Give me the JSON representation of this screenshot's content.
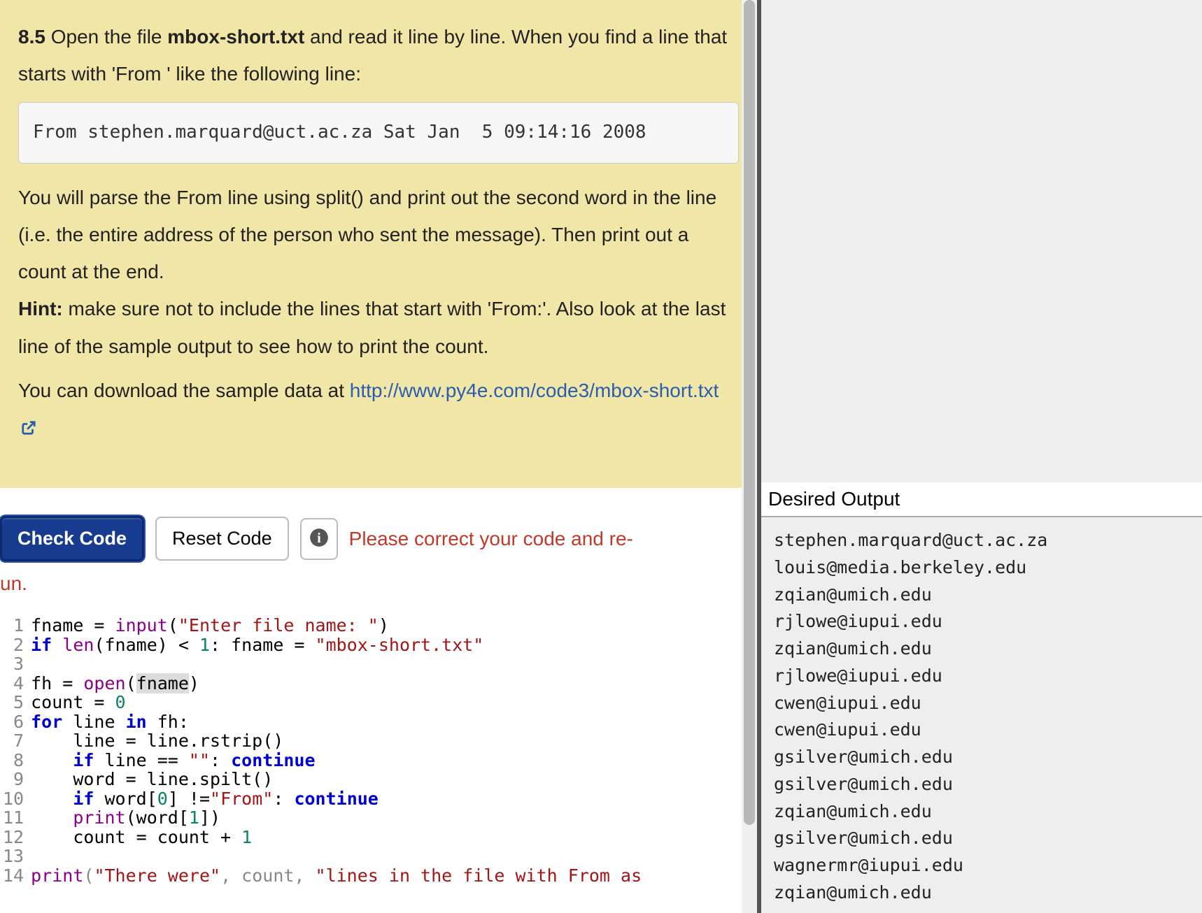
{
  "exercise": {
    "number": "8.5",
    "intro_before_file": " Open the file ",
    "filename": "mbox-short.txt",
    "intro_after_file": " and read it line by line. When you find a line that starts with 'From ' like the following line:",
    "sample_line": "From stephen.marquard@uct.ac.za Sat Jan  5 09:14:16 2008",
    "para2": "You will parse the From line using split() and print out the second word in the line (i.e. the entire address of the person who sent the message). Then print out a count at the end.",
    "hint_label": "Hint:",
    "hint_text": " make sure not to include the lines that start with 'From:'. Also look at the last line of the sample output to see how to print the count.",
    "download_prefix": "You can download the sample data at ",
    "download_link_text": "http://www.py4e.com/code3/mbox-short.txt"
  },
  "toolbar": {
    "check_label": "Check Code",
    "reset_label": "Reset Code",
    "error_msg": "Please correct your code and re-",
    "error_msg_cont": "un."
  },
  "editor": {
    "lines": [
      "fname = input(\"Enter file name: \")",
      "if len(fname) < 1: fname = \"mbox-short.txt\"",
      "",
      "fh = open(fname)",
      "count = 0",
      "for line in fh:",
      "    line = line.rstrip()",
      "    if line == \"\": continue",
      "    word = line.spilt()",
      "    if word[0] !=\"From\": continue",
      "    print(word[1])",
      "    count = count + 1",
      "",
      "print(\"There were\", count, \"lines in the file with From as"
    ],
    "line_numbers": " 1\n 2\n 3\n 4\n 5\n 6\n 7\n 8\n 9\n10\n11\n12\n13\n14"
  },
  "output": {
    "header": "Desired Output",
    "lines": "stephen.marquard@uct.ac.za\nlouis@media.berkeley.edu\nzqian@umich.edu\nrjlowe@iupui.edu\nzqian@umich.edu\nrjlowe@iupui.edu\ncwen@iupui.edu\ncwen@iupui.edu\ngsilver@umich.edu\ngsilver@umich.edu\nzqian@umich.edu\ngsilver@umich.edu\nwagnermr@iupui.edu\nzqian@umich.edu"
  }
}
